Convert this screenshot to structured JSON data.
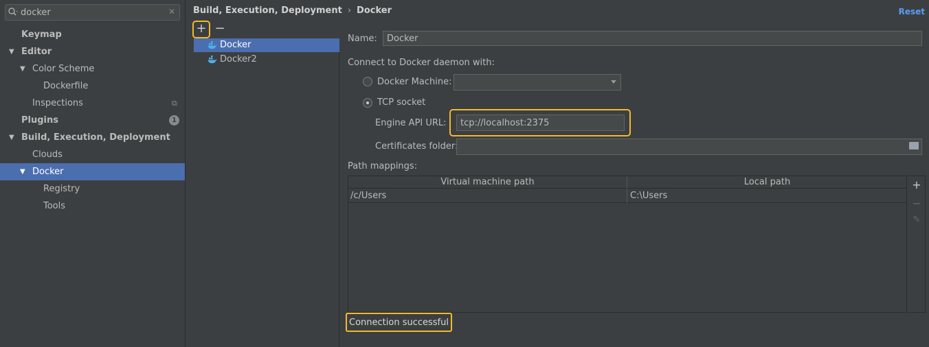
{
  "search": {
    "value": "docker"
  },
  "tree": [
    {
      "label": "Keymap"
    },
    {
      "label": "Editor"
    },
    {
      "label": "Color Scheme"
    },
    {
      "label": "Dockerfile"
    },
    {
      "label": "Inspections"
    },
    {
      "label": "Plugins",
      "badge": "1"
    },
    {
      "label": "Build, Execution, Deployment"
    },
    {
      "label": "Clouds"
    },
    {
      "label": "Docker"
    },
    {
      "label": "Registry"
    },
    {
      "label": "Tools"
    }
  ],
  "breadcrumb": {
    "parent": "Build, Execution, Deployment",
    "sep": "›",
    "current": "Docker"
  },
  "reset_label": "Reset",
  "list_toolbar": {
    "add": "+",
    "remove": "−"
  },
  "configs": [
    {
      "label": "Docker"
    },
    {
      "label": "Docker2"
    }
  ],
  "form": {
    "name_label": "Name:",
    "name_value": "Docker",
    "connect_label": "Connect to Docker daemon with:",
    "docker_machine_label": "Docker Machine:",
    "docker_machine_value": "",
    "tcp_label": "TCP socket",
    "engine_label": "Engine API URL:",
    "engine_value": "tcp://localhost:2375",
    "cert_label": "Certificates folder:",
    "cert_value": "",
    "path_label": "Path mappings:"
  },
  "table": {
    "headers": [
      "Virtual machine path",
      "Local path"
    ],
    "rows": [
      {
        "vm": "/c/Users",
        "local": "C:\\Users"
      }
    ]
  },
  "status": "Connection successful",
  "colors": {
    "selection": "#4b6eaf",
    "highlight": "#f5b92b",
    "link": "#589df6",
    "background": "#3c3f41"
  }
}
